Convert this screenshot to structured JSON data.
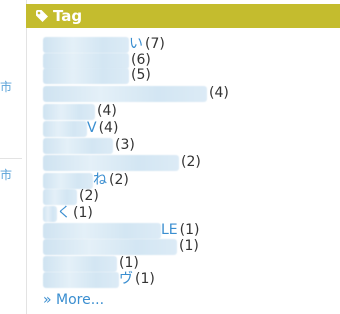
{
  "left_fragments": [
    "市",
    "市"
  ],
  "widget": {
    "title": "Tag",
    "icon": "tag-icon",
    "header_color": "#c4bc2e",
    "link_color": "#3a8ed0"
  },
  "tags": [
    {
      "visible": "い",
      "count": "(7)"
    },
    {
      "visible": "",
      "count": "(6)"
    },
    {
      "visible": "",
      "count": "(5)"
    },
    {
      "visible": "",
      "count": "(4)"
    },
    {
      "visible": "",
      "count": "(4)"
    },
    {
      "visible": "V",
      "count": "(4)"
    },
    {
      "visible": "",
      "count": "(3)"
    },
    {
      "visible": "",
      "count": "(2)"
    },
    {
      "visible": "ね",
      "count": "(2)"
    },
    {
      "visible": "",
      "count": "(2)"
    },
    {
      "visible": "く",
      "count": "(1)"
    },
    {
      "visible": "LE",
      "count": "(1)"
    },
    {
      "visible": "",
      "count": "(1)"
    },
    {
      "visible": "",
      "count": "(1)"
    },
    {
      "visible": "ヴ",
      "count": "(1)"
    }
  ],
  "more": "» More..."
}
